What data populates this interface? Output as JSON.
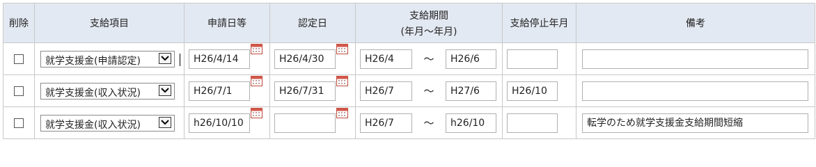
{
  "headers": {
    "delete": "削除",
    "item": "支給項目",
    "apply_date": "申請日等",
    "approve_date": "認定日",
    "period_line1": "支給期間",
    "period_line2": "(年月～年月)",
    "stop_month": "支給停止年月",
    "note": "備考"
  },
  "period_separator": "～",
  "icons": {
    "calendar": "calendar-icon",
    "dropdown": "chevron-down-icon"
  },
  "rows": [
    {
      "checked": false,
      "item": "就学支援金(申請認定)",
      "apply_date": "H26/4/14",
      "approve_date": "H26/4/30",
      "period_from": "H26/4",
      "period_to": "H26/6",
      "stop_month": "",
      "note": ""
    },
    {
      "checked": false,
      "item": "就学支援金(収入状況)",
      "apply_date": "H26/7/1",
      "approve_date": "H26/7/31",
      "period_from": "H26/7",
      "period_to": "H27/6",
      "stop_month": "H26/10",
      "note": ""
    },
    {
      "checked": false,
      "item": "就学支援金(収入状況)",
      "apply_date": "h26/10/10",
      "approve_date": "",
      "period_from": "H26/7",
      "period_to": "h26/10",
      "stop_month": "",
      "note": "転学のため就学支援金支給期間短縮"
    }
  ]
}
